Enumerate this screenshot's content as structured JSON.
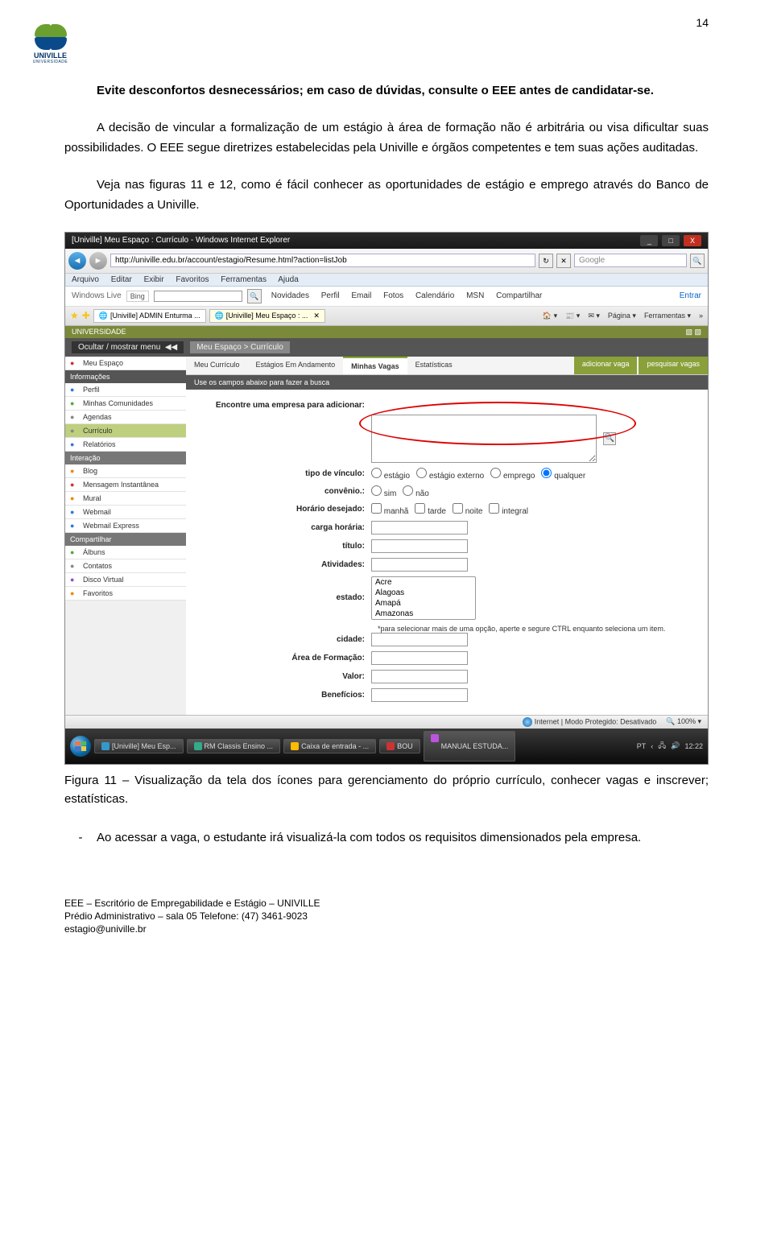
{
  "page_number": "14",
  "logo": {
    "name": "UNIVILLE",
    "sub": "UNIVERSIDADE"
  },
  "paragraphs": {
    "p1": "Evite desconfortos desnecessários; em caso de dúvidas, consulte o EEE antes de candidatar-se.",
    "p2": "A decisão de vincular a formalização de um estágio à área de formação não é arbitrária ou visa dificultar suas possibilidades. O EEE segue diretrizes estabelecidas pela Univille e órgãos competentes e tem suas ações auditadas.",
    "p3": "Veja nas figuras 11 e 12, como é fácil conhecer as oportunidades de estágio e emprego através do Banco de Oportunidades a Univille."
  },
  "screenshot": {
    "title": "[Univille] Meu Espaço : Currículo - Windows Internet Explorer",
    "url": "http://univille.edu.br/account/estagio/Resume.html?action=listJob",
    "search_placeholder": "Google",
    "menu": {
      "arquivo": "Arquivo",
      "editar": "Editar",
      "exibir": "Exibir",
      "favoritos": "Favoritos",
      "ferramentas": "Ferramentas",
      "ajuda": "Ajuda"
    },
    "live": {
      "brand": "Windows Live",
      "bing": "Bing",
      "links": {
        "novidades": "Novidades",
        "perfil": "Perfil",
        "email": "Email",
        "fotos": "Fotos",
        "calendario": "Calendário",
        "msn": "MSN",
        "compartilhar": "Compartilhar"
      },
      "entrar": "Entrar"
    },
    "ietabs": {
      "tab1": "[Univille] ADMIN Enturma ...",
      "tab2": "[Univille] Meu Espaço : ...",
      "pagina": "Página ▾",
      "ferramentas": "Ferramentas ▾"
    },
    "segbar": {
      "ocultar": "Ocultar / mostrar menu",
      "crumb": "Meu Espaço > Currículo"
    },
    "sidebar": {
      "meu_espaco": "Meu Espaço",
      "hd_info": "Informações",
      "perfil": "Perfil",
      "comunidades": "Minhas Comunidades",
      "agendas": "Agendas",
      "curriculo": "Currículo",
      "relatorios": "Relatórios",
      "hd_inter": "Interação",
      "blog": "Blog",
      "mensagem": "Mensagem Instantânea",
      "mural": "Mural",
      "webmail": "Webmail",
      "webmail_ex": "Webmail Express",
      "hd_comp": "Compartilhar",
      "albuns": "Álbuns",
      "contatos": "Contatos",
      "disco": "Disco Virtual",
      "favoritos": "Favoritos"
    },
    "subtabs": {
      "t1": "Meu Currículo",
      "t2": "Estágios Em Andamento",
      "t3": "Minhas Vagas",
      "t4": "Estatísticas",
      "add": "adicionar vaga",
      "search": "pesquisar vagas"
    },
    "darkstrip": "Use os campos abaixo para fazer a busca",
    "form": {
      "encontre": "Encontre uma empresa para adicionar:",
      "tipo_label": "tipo de vínculo:",
      "tipo_opts": {
        "estagio": "estágio",
        "externo": "estágio externo",
        "emprego": "emprego",
        "qualquer": "qualquer"
      },
      "convenio_label": "convênio.:",
      "conv_sim": "sim",
      "conv_nao": "não",
      "horario_label": "Horário desejado:",
      "h_manha": "manhã",
      "h_tarde": "tarde",
      "h_noite": "noite",
      "h_int": "integral",
      "carga_label": "carga horária:",
      "titulo_label": "título:",
      "ativ_label": "Atividades:",
      "estado_label": "estado:",
      "estados": {
        "e1": "Acre",
        "e2": "Alagoas",
        "e3": "Amapá",
        "e4": "Amazonas"
      },
      "estado_note": "*para selecionar mais de uma opção, aperte e segure CTRL enquanto seleciona um item.",
      "cidade_label": "cidade:",
      "area_label": "Área de Formação:",
      "valor_label": "Valor:",
      "benef_label": "Benefícios:"
    },
    "status": {
      "internet": "Internet | Modo Protegido: Desativado",
      "zoom": "100%"
    },
    "taskbar": {
      "t1": "[Univille] Meu Esp...",
      "t2": "RM Classis Ensino ...",
      "t3": "Caixa de entrada - ...",
      "t4": "BOU",
      "t5": "MANUAL ESTUDA...",
      "lang": "PT",
      "time": "12:22"
    }
  },
  "caption": "Figura 11 – Visualização da tela dos ícones para gerenciamento do próprio currículo, conhecer vagas e inscrever; estatísticas.",
  "bullet": "Ao acessar a vaga, o estudante irá visualizá-la com todos os requisitos dimensionados pela empresa.",
  "footer": {
    "l1": "EEE – Escritório de Empregabilidade e Estágio – UNIVILLE",
    "l2": "Prédio Administrativo – sala 05    Telefone: (47) 3461-9023",
    "l3": "estagio@univille.br"
  }
}
